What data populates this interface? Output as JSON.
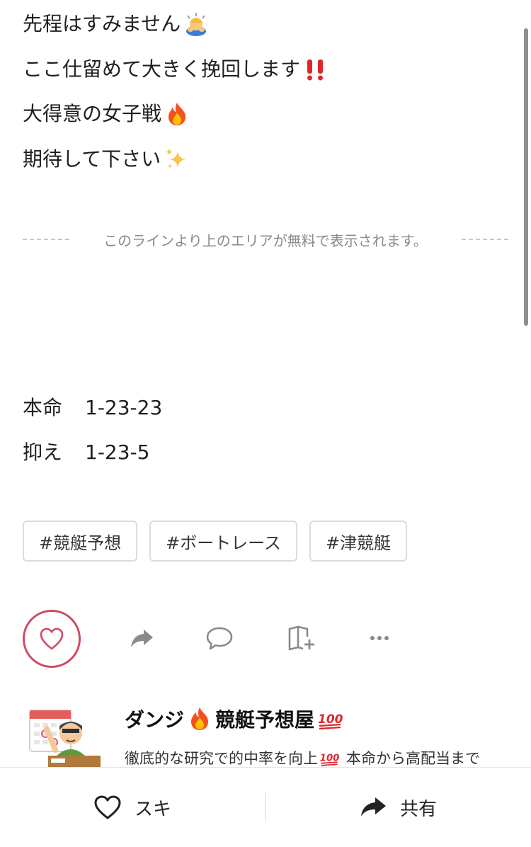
{
  "intro": {
    "line1": "先程はすみません",
    "line2": "ここ仕留めて大きく挽回します",
    "line3": "大得意の女子戦",
    "line4": "期待して下さい"
  },
  "paywall": {
    "text": "このラインより上のエリアが無料で表示されます。"
  },
  "picks": {
    "main_label": "本命",
    "main_value": "1-23-23",
    "backup_label": "抑え",
    "backup_value": "1-23-5"
  },
  "tags": [
    "#競艇予想",
    "#ボートレース",
    "#津競艇"
  ],
  "creator": {
    "name_part1": "ダンジ",
    "name_part2": "競艇予想屋",
    "desc_part1": "徹底的な研究で的中率を向上",
    "desc_part2": "本命から高配当まで"
  },
  "bottom_bar": {
    "like_label": "スキ",
    "share_label": "共有"
  },
  "colors": {
    "like_accent": "#d04a63",
    "icon_gray": "#8a8a8a"
  },
  "icons": [
    "bowing-person-emoji",
    "double-exclamation-emoji",
    "fire-emoji",
    "sparkles-emoji",
    "hundred-points-emoji",
    "heart-icon",
    "share-arrow-icon",
    "comment-icon",
    "add-to-magazine-icon",
    "more-icon"
  ]
}
